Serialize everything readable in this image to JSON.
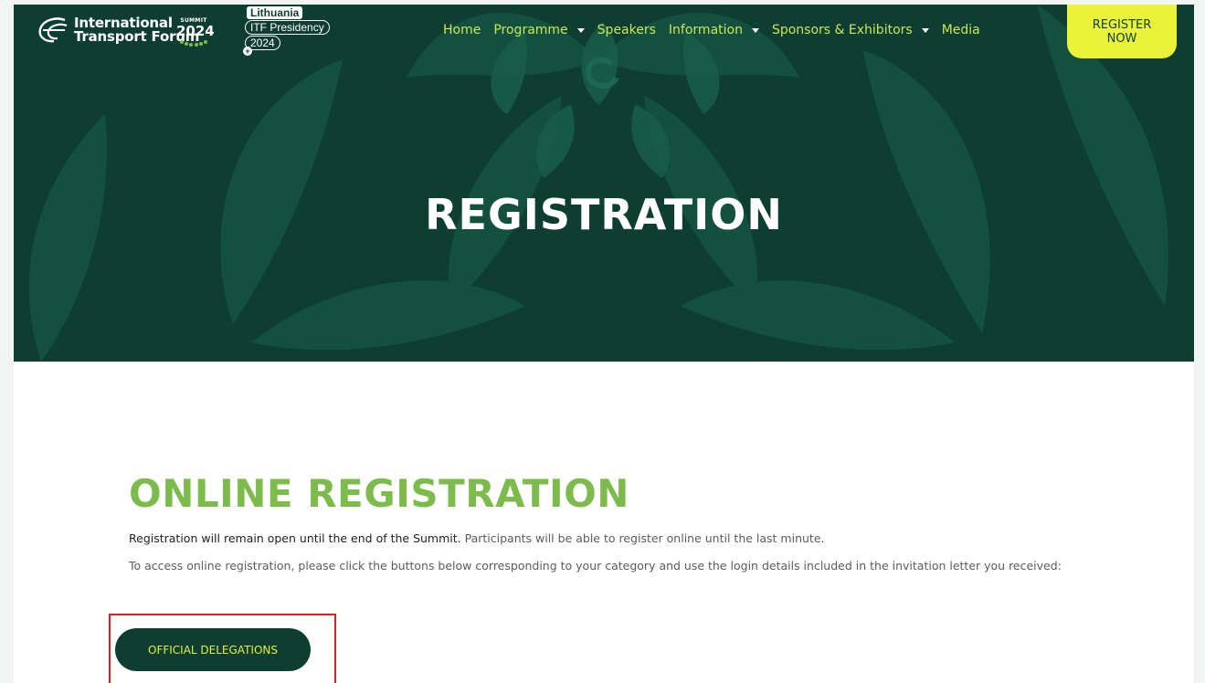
{
  "header": {
    "logo": {
      "line1": "International",
      "line2": "Transport Forum"
    },
    "summit_badge": {
      "small": "SUMMIT",
      "year": "2024"
    },
    "presidency": {
      "country": "Lithuania",
      "label": "ITF Presidency",
      "year": "2024"
    },
    "nav": [
      {
        "label": "Home",
        "dropdown": false
      },
      {
        "label": "Programme",
        "dropdown": true
      },
      {
        "label": "Speakers",
        "dropdown": false
      },
      {
        "label": "Information",
        "dropdown": true
      },
      {
        "label": "Sponsors & Exhibitors",
        "dropdown": true
      },
      {
        "label": "Media",
        "dropdown": false
      }
    ],
    "register_now": {
      "line1": "REGISTER",
      "line2": "NOW"
    }
  },
  "hero": {
    "title": "REGISTRATION"
  },
  "main": {
    "section_title": "ONLINE REGISTRATION",
    "para1_strong": "Registration will remain open until the end of the Summit.",
    "para1_rest": " Participants will be able to register online until the last minute.",
    "para2": "To access online registration, please click the buttons below corresponding to your category and use the login details included in the invitation letter you received:",
    "official_button": "OFFICIAL DELEGATIONS"
  },
  "colors": {
    "hero_bg": "#0e3e31",
    "nav_text": "#c8e855",
    "register_bg": "#eaf339",
    "section_title": "#7dbb4d",
    "highlight": "#e0201c"
  }
}
